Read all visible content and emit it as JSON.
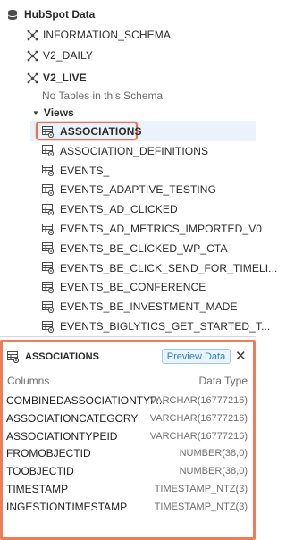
{
  "tree": {
    "root": {
      "label": "HubSpot Data",
      "icon": "database-icon"
    },
    "schemas": [
      {
        "label": "INFORMATION_SCHEMA"
      },
      {
        "label": "V2_DAILY"
      },
      {
        "label": "V2_LIVE"
      }
    ],
    "empty_message": "No Tables in this Schema",
    "views_label": "Views",
    "views": [
      "ASSOCIATIONS",
      "ASSOCIATION_DEFINITIONS",
      "EVENTS_",
      "EVENTS_ADAPTIVE_TESTING",
      "EVENTS_AD_CLICKED",
      "EVENTS_AD_METRICS_IMPORTED_V0",
      "EVENTS_BE_CLICKED_WP_CTA",
      "EVENTS_BE_CLICK_SEND_FOR_TIMELI...",
      "EVENTS_BE_CONFERENCE",
      "EVENTS_BE_INVESTMENT_MADE",
      "EVENTS_BIGLYTICS_GET_STARTED_T..."
    ]
  },
  "details": {
    "title": "ASSOCIATIONS",
    "preview_label": "Preview Data",
    "close_label": "✕",
    "columns_header": "Columns",
    "type_header": "Data Type",
    "columns": [
      {
        "name": "COMBINEDASSOCIATIONTYP...",
        "type": "VARCHAR(16777216)"
      },
      {
        "name": "ASSOCIATIONCATEGORY",
        "type": "VARCHAR(16777216)"
      },
      {
        "name": "ASSOCIATIONTYPEID",
        "type": "VARCHAR(16777216)"
      },
      {
        "name": "FROMOBJECTID",
        "type": "NUMBER(38,0)"
      },
      {
        "name": "TOOBJECTID",
        "type": "NUMBER(38,0)"
      },
      {
        "name": "TIMESTAMP",
        "type": "TIMESTAMP_NTZ(3)"
      },
      {
        "name": "INGESTIONTIMESTAMP",
        "type": "TIMESTAMP_NTZ(3)"
      }
    ]
  },
  "colors": {
    "accent": "#ef7d5a",
    "selection": "#eaf3fb",
    "link": "#2a7fd4"
  }
}
